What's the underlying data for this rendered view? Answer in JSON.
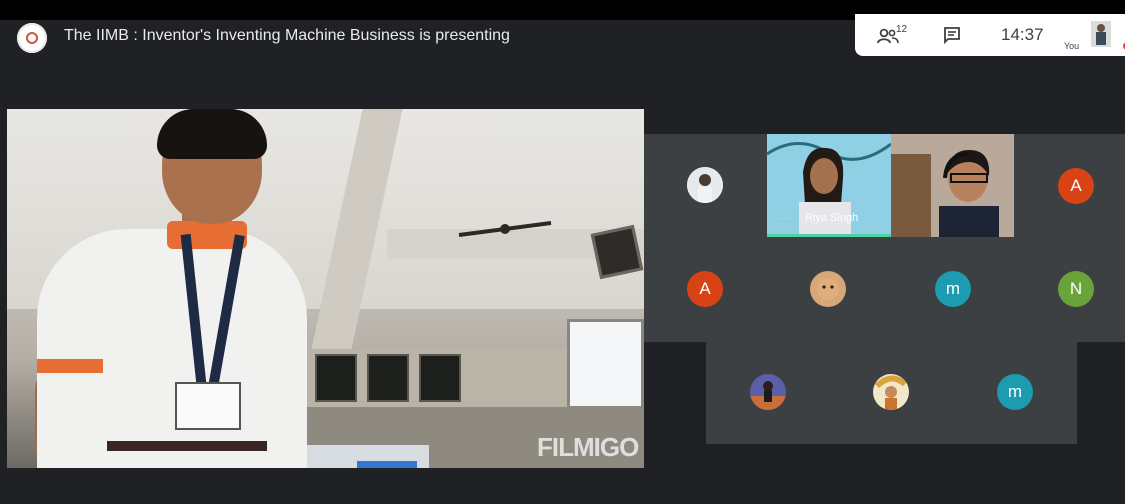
{
  "meeting": {
    "title": "The IIMB : Inventor's Inventing Machine Business is presenting"
  },
  "controls": {
    "participants_count": "12",
    "clock": "14:37",
    "self_label": "You"
  },
  "presenter": {
    "watermark": "FILMIGO"
  },
  "participants": [
    {
      "label": "A",
      "color": "#d84315"
    },
    {
      "label": "A",
      "color": "#d84315"
    },
    {
      "label": "m",
      "color": "#1d9bb0"
    },
    {
      "label": "N",
      "color": "#6aa339"
    },
    {
      "label": "m",
      "color": "#1d9bb0"
    }
  ],
  "speaker_tile": {
    "name": "Riya Singh"
  }
}
